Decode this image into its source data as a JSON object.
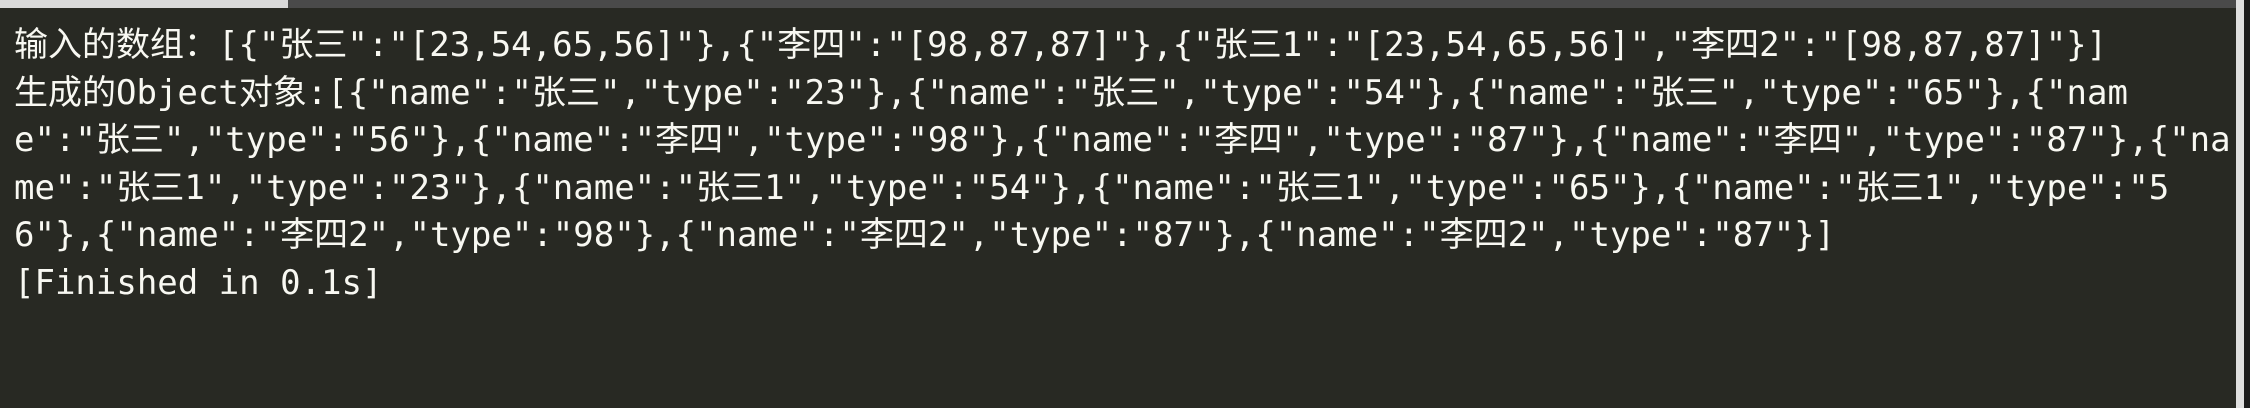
{
  "console": {
    "line1": "输入的数组：[{\"张三\":\"[23,54,65,56]\"},{\"李四\":\"[98,87,87]\"},{\"张三1\":\"[23,54,65,56]\",\"李四2\":\"[98,87,87]\"}]",
    "line2": "生成的Object对象:[{\"name\":\"张三\",\"type\":\"23\"},{\"name\":\"张三\",\"type\":\"54\"},{\"name\":\"张三\",\"type\":\"65\"},{\"name\":\"张三\",\"type\":\"56\"},{\"name\":\"李四\",\"type\":\"98\"},{\"name\":\"李四\",\"type\":\"87\"},{\"name\":\"李四\",\"type\":\"87\"},{\"name\":\"张三1\",\"type\":\"23\"},{\"name\":\"张三1\",\"type\":\"54\"},{\"name\":\"张三1\",\"type\":\"65\"},{\"name\":\"张三1\",\"type\":\"56\"},{\"name\":\"李四2\",\"type\":\"98\"},{\"name\":\"李四2\",\"type\":\"87\"},{\"name\":\"李四2\",\"type\":\"87\"}]",
    "line3": "[Finished in 0.1s]"
  }
}
